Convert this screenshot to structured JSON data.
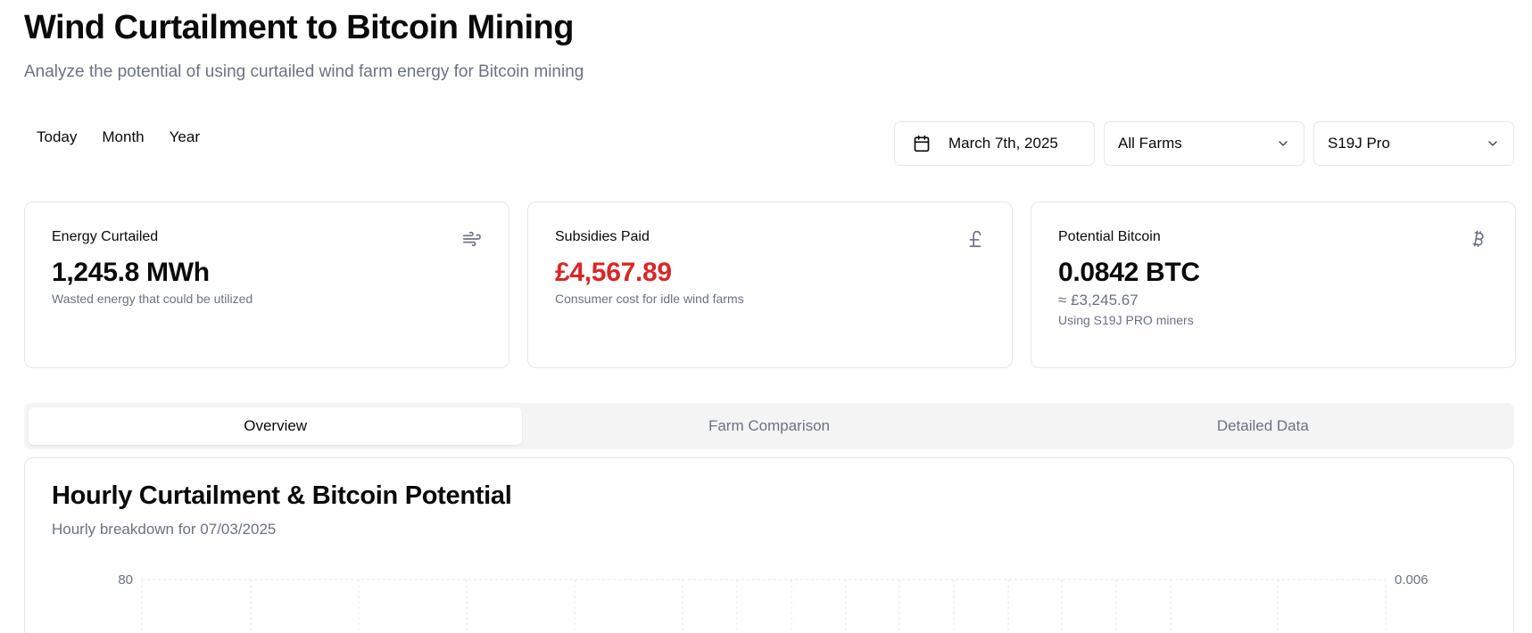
{
  "header": {
    "title": "Wind Curtailment to Bitcoin Mining",
    "subtitle": "Analyze the potential of using curtailed wind farm energy for Bitcoin mining"
  },
  "period_tabs": [
    "Today",
    "Month",
    "Year"
  ],
  "filters": {
    "date": "March 7th, 2025",
    "farm": "All Farms",
    "miner": "S19J Pro"
  },
  "cards": {
    "energy": {
      "title": "Energy Curtailed",
      "value": "1,245.8 MWh",
      "description": "Wasted energy that could be utilized",
      "icon": "wind-icon"
    },
    "subsidies": {
      "title": "Subsidies Paid",
      "value": "£4,567.89",
      "description": "Consumer cost for idle wind farms",
      "icon": "pound-icon",
      "value_color": "#dc2626"
    },
    "bitcoin": {
      "title": "Potential Bitcoin",
      "value": "0.0842 BTC",
      "sub_value": "≈ £3,245.67",
      "description": "Using S19J PRO miners",
      "icon": "bitcoin-icon"
    }
  },
  "main_tabs": {
    "overview": "Overview",
    "farm_comparison": "Farm Comparison",
    "detailed_data": "Detailed Data",
    "active": "Overview"
  },
  "chart": {
    "title": "Hourly Curtailment & Bitcoin Potential",
    "subtitle": "Hourly breakdown for 07/03/2025"
  },
  "chart_data": {
    "type": "bar",
    "title": "Hourly Curtailment & Bitcoin Potential",
    "y_left_ticks": [
      "80"
    ],
    "y_right_ticks": [
      "0.006"
    ],
    "y_left_max": 80,
    "y_right_max": 0.006,
    "grid": true
  },
  "colors": {
    "text": "#0a0a0a",
    "muted": "#6b7280",
    "border": "#e5e7eb",
    "negative": "#dc2626",
    "tab_bg": "#f4f4f5"
  }
}
